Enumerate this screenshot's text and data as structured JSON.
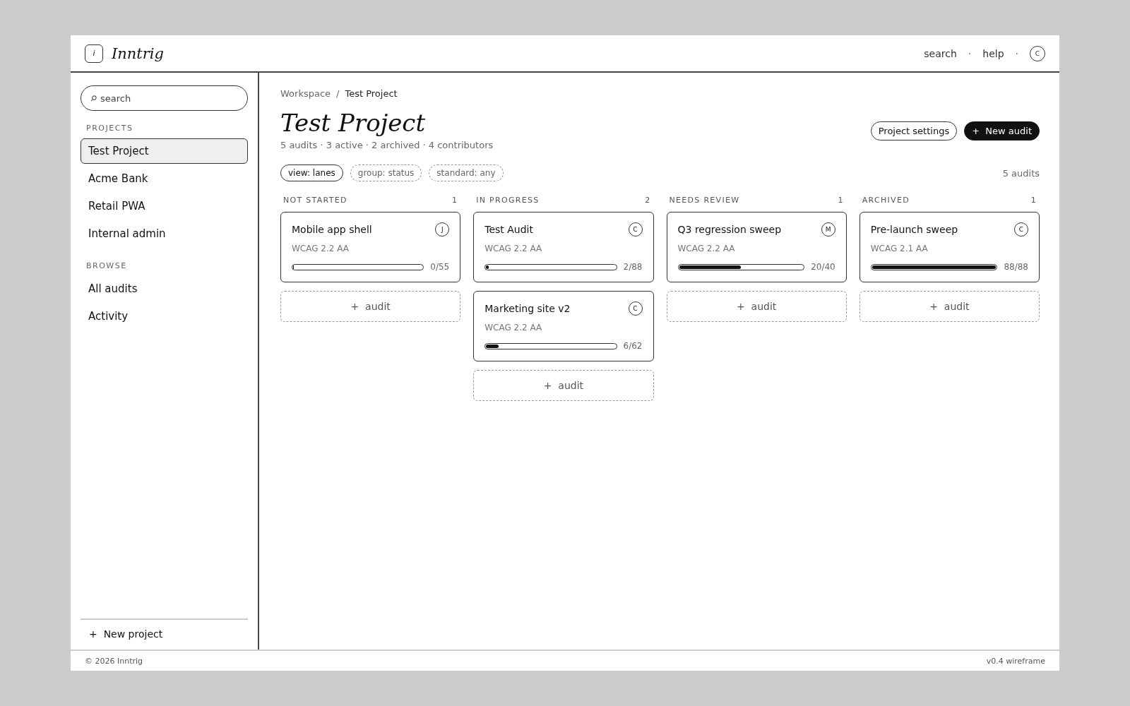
{
  "header": {
    "logo_mark": "i",
    "brand": "Inntrig",
    "nav": [
      "search",
      "help"
    ],
    "separator": "·",
    "avatar": "C"
  },
  "sidebar": {
    "search": {
      "placeholder": "search"
    },
    "sections": [
      {
        "title": "PROJECTS",
        "items": [
          {
            "label": "Test Project",
            "selected": true
          },
          {
            "label": "Acme Bank",
            "selected": false
          },
          {
            "label": "Retail PWA",
            "selected": false
          },
          {
            "label": "Internal admin",
            "selected": false
          }
        ]
      },
      {
        "title": "BROWSE",
        "items": [
          {
            "label": "All audits",
            "selected": false
          },
          {
            "label": "Activity",
            "selected": false
          }
        ]
      }
    ],
    "new_project": "+  New project"
  },
  "main": {
    "breadcrumb": [
      "Workspace",
      "Test Project"
    ],
    "breadcrumb_separator": "/",
    "title": "Test Project",
    "summary": "5 audits · 3 active · 2 archived · 4 contributors",
    "actions": [
      {
        "label": "Project settings",
        "kind": "secondary"
      },
      {
        "label": "+  New audit",
        "kind": "primary"
      }
    ],
    "filters": [
      {
        "label": "view: lanes",
        "selected": true
      },
      {
        "label": "group: status",
        "selected": false
      },
      {
        "label": "standard: any",
        "selected": false
      }
    ],
    "count": "5 audits",
    "lanes": [
      {
        "title": "NOT STARTED",
        "count": "1",
        "add_label": "+  audit",
        "cards": [
          {
            "title": "Mobile app shell",
            "standard": "WCAG 2.2 AA",
            "avatar": "J",
            "level": 0,
            "progress": "0/55"
          }
        ]
      },
      {
        "title": "IN PROGRESS",
        "count": "2",
        "add_label": "+  audit",
        "cards": [
          {
            "title": "Test Audit",
            "standard": "WCAG 2.2 AA",
            "avatar": "C",
            "level": 0.023,
            "progress": "2/88"
          },
          {
            "title": "Marketing site v2",
            "standard": "WCAG 2.2 AA",
            "avatar": "C",
            "level": 0.097,
            "progress": "6/62"
          }
        ]
      },
      {
        "title": "NEEDS REVIEW",
        "count": "1",
        "add_label": "+  audit",
        "cards": [
          {
            "title": "Q3 regression sweep",
            "standard": "WCAG 2.2 AA",
            "avatar": "M",
            "level": 0.5,
            "progress": "20/40"
          }
        ]
      },
      {
        "title": "ARCHIVED",
        "count": "1",
        "add_label": "+  audit",
        "cards": [
          {
            "title": "Pre-launch sweep",
            "standard": "WCAG 2.1 AA",
            "avatar": "C",
            "level": 1,
            "progress": "88/88"
          }
        ]
      }
    ]
  },
  "footer": {
    "left": "© 2026 Inntrig",
    "right": "v0.4 wireframe"
  }
}
